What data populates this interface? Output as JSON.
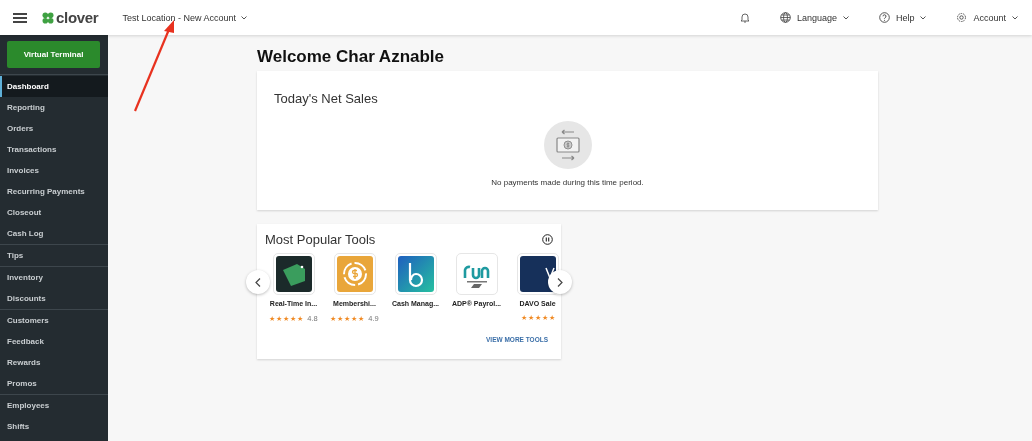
{
  "top_bar": {
    "logo": "clover",
    "location": "Test Location - New Account",
    "menus": [
      {
        "kind": "language",
        "label": "Language"
      },
      {
        "kind": "help",
        "label": "Help"
      },
      {
        "kind": "account",
        "label": "Account"
      }
    ]
  },
  "sidebar": {
    "action_button": "Virtual Terminal",
    "groups": [
      [
        {
          "label": "Dashboard",
          "selected": true
        },
        {
          "label": "Reporting",
          "selected": false
        },
        {
          "label": "Orders",
          "selected": false
        },
        {
          "label": "Transactions",
          "selected": false
        },
        {
          "label": "Invoices",
          "selected": false
        },
        {
          "label": "Recurring Payments",
          "selected": false
        },
        {
          "label": "Closeout",
          "selected": false
        },
        {
          "label": "Cash Log",
          "selected": false
        }
      ],
      [
        {
          "label": "Tips",
          "selected": false
        }
      ],
      [
        {
          "label": "Inventory",
          "selected": false
        },
        {
          "label": "Discounts",
          "selected": false
        }
      ],
      [
        {
          "label": "Customers",
          "selected": false
        },
        {
          "label": "Feedback",
          "selected": false
        },
        {
          "label": "Rewards",
          "selected": false
        },
        {
          "label": "Promos",
          "selected": false
        }
      ],
      [
        {
          "label": "Employees",
          "selected": false
        },
        {
          "label": "Shifts",
          "selected": false
        }
      ]
    ]
  },
  "welcome": "Welcome Char Aznable",
  "net_sales": {
    "title": "Today's Net Sales",
    "message": "No payments made during this time period."
  },
  "popular_tools": {
    "title": "Most Popular Tools",
    "tools": [
      {
        "kind": "iq",
        "name": "Real-Time In...",
        "stars": 5,
        "rating": "4.8"
      },
      {
        "kind": "membership",
        "name": "Membershi...",
        "stars": 5,
        "rating": "4.9"
      },
      {
        "kind": "cash",
        "name": "Cash Manag..."
      },
      {
        "kind": "run",
        "name": "ADP® Payrol..."
      },
      {
        "kind": "davo",
        "name": "DAVO Sale",
        "stars": 5
      }
    ],
    "link": "VIEW MORE TOOLS"
  }
}
